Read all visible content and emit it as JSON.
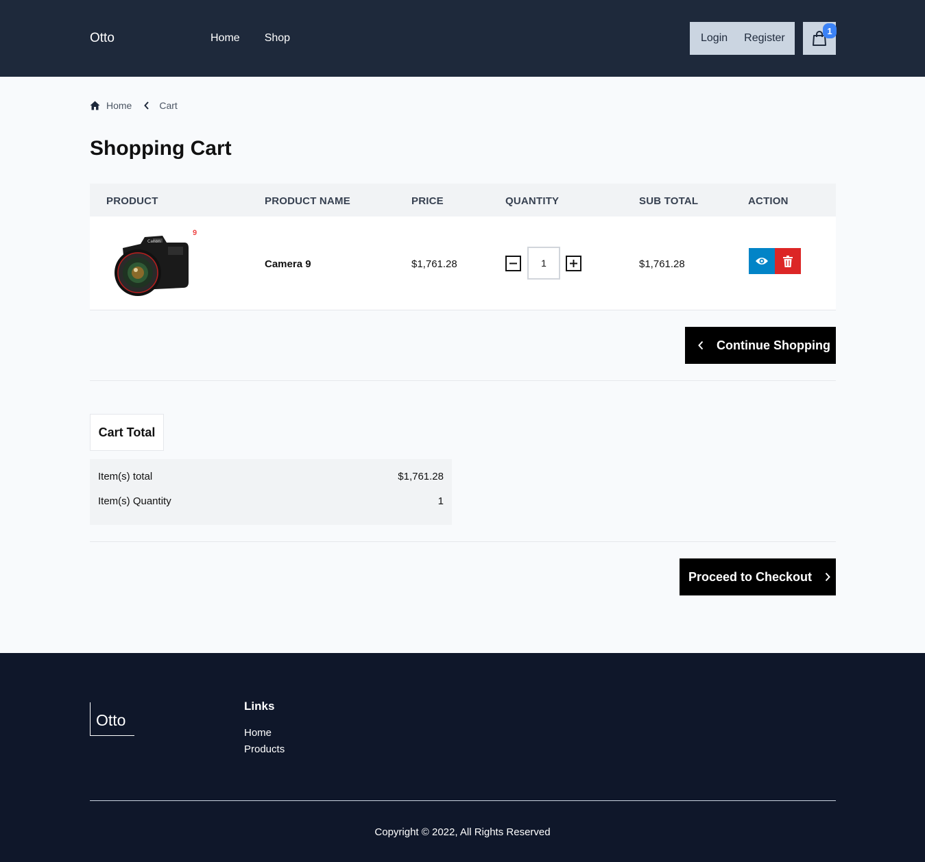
{
  "header": {
    "brand": "Otto",
    "nav": [
      "Home",
      "Shop"
    ],
    "login": "Login",
    "register": "Register",
    "cart_count": "1"
  },
  "breadcrumb": {
    "home": "Home",
    "current": "Cart"
  },
  "page_title": "Shopping Cart",
  "table": {
    "headers": [
      "PRODUCT",
      "PRODUCT NAME",
      "PRICE",
      "QUANTITY",
      "SUB TOTAL",
      "ACTION"
    ],
    "rows": [
      {
        "image_label": "9",
        "name": "Camera 9",
        "price": "$1,761.28",
        "quantity": "1",
        "subtotal": "$1,761.28"
      }
    ]
  },
  "continue_label": "Continue Shopping",
  "cart_total": {
    "title": "Cart Total",
    "items_total_label": "Item(s) total",
    "items_total_value": "$1,761.28",
    "items_qty_label": "Item(s) Quantity",
    "items_qty_value": "1"
  },
  "checkout_label": "Proceed to Checkout",
  "footer": {
    "brand": "Otto",
    "links_title": "Links",
    "links": [
      "Home",
      "Products"
    ],
    "copyright": "Copyright © 2022, All Rights Reserved"
  },
  "colors": {
    "header_bg": "#1e293b",
    "footer_bg": "#0f172a",
    "badge": "#3b82f6",
    "view_button": "#0284c7",
    "delete_button": "#dc2626"
  },
  "icons": [
    "home-icon",
    "chevron-left-icon",
    "shopping-bag-icon",
    "eye-icon",
    "trash-icon",
    "minus-icon",
    "plus-icon",
    "chevron-right-icon"
  ]
}
